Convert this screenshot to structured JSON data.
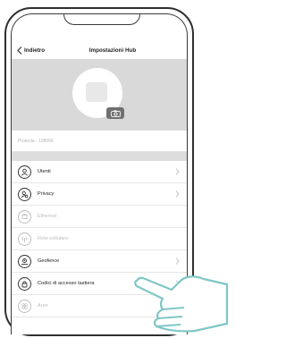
{
  "nav": {
    "back_label": "Indietro",
    "title": "Impostazioni Hub"
  },
  "hub": {
    "name": "Protecta - 108006"
  },
  "menu": [
    {
      "label": "Utenti",
      "icon": "user-icon",
      "enabled": true
    },
    {
      "label": "Privacy",
      "icon": "privacy-icon",
      "enabled": true
    },
    {
      "label": "Ethernet",
      "icon": "ethernet-icon",
      "enabled": false
    },
    {
      "label": "Rete cellulare",
      "icon": "cellular-icon",
      "enabled": false
    },
    {
      "label": "Geofence",
      "icon": "geofence-icon",
      "enabled": true
    },
    {
      "label": "Codici di accesso tastiera",
      "icon": "lock-icon",
      "enabled": true
    },
    {
      "label": "Aree",
      "icon": "areas-icon",
      "enabled": false
    }
  ],
  "colors": {
    "hero_bg": "#d9d9d9",
    "hand_stroke": "#7fc7c6",
    "separator": "#dddddd"
  }
}
